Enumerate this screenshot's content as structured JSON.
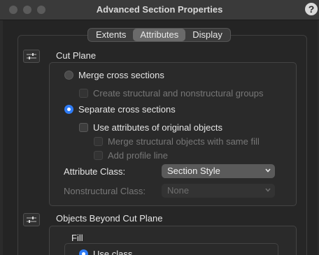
{
  "window": {
    "title": "Advanced Section Properties",
    "help_label": "?"
  },
  "tabs": [
    {
      "label": "Extents",
      "active": false
    },
    {
      "label": "Attributes",
      "active": true
    },
    {
      "label": "Display",
      "active": false
    }
  ],
  "cut_plane": {
    "label": "Cut Plane",
    "merge_radio": {
      "label": "Merge cross sections",
      "selected": false
    },
    "create_groups": {
      "label": "Create structural and nonstructural groups",
      "checked": false,
      "enabled": false
    },
    "separate_radio": {
      "label": "Separate cross sections",
      "selected": true
    },
    "use_attributes": {
      "label": "Use attributes of original objects",
      "checked": false,
      "enabled": true
    },
    "merge_structural": {
      "label": "Merge structural objects with same fill",
      "checked": false,
      "enabled": false
    },
    "add_profile": {
      "label": "Add profile line",
      "checked": false,
      "enabled": false
    },
    "attribute_class": {
      "label": "Attribute Class:",
      "value": "Section Style"
    },
    "nonstructural_class": {
      "label": "Nonstructural Class:",
      "value": "None"
    }
  },
  "beyond": {
    "label": "Objects Beyond Cut Plane",
    "fill_label": "Fill",
    "use_class_partial": "Use class"
  },
  "colors": {
    "accent": "#2f7cf6",
    "titlebar": "#3a3a3a",
    "background": "#242424"
  },
  "icons": [
    "settings-sliders-icon",
    "chevron-down-icon"
  ]
}
